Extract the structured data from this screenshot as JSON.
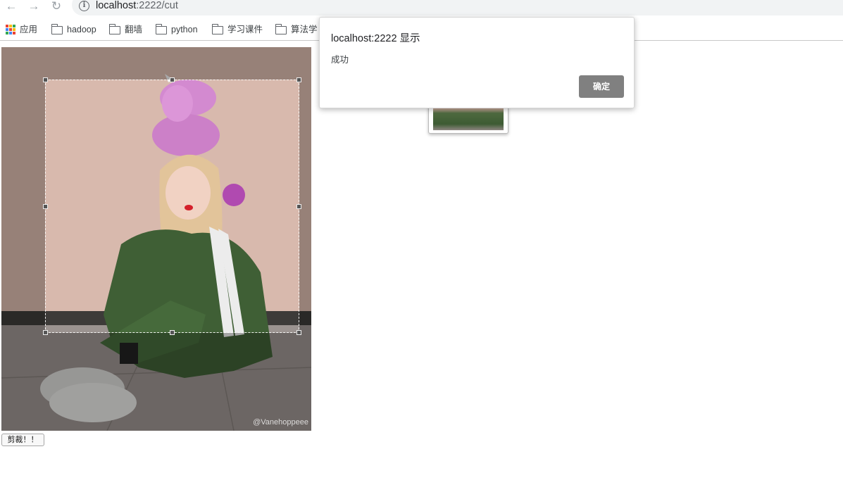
{
  "browser": {
    "url_host": "localhost",
    "url_path": ":2222/cut",
    "nav": {
      "back": "←",
      "forward": "→",
      "reload": "↻"
    }
  },
  "bookmarks": [
    {
      "label": "应用",
      "icon": "apps-grid-icon"
    },
    {
      "label": "hadoop",
      "icon": "folder-icon"
    },
    {
      "label": "翻墙",
      "icon": "folder-icon"
    },
    {
      "label": "python",
      "icon": "folder-icon"
    },
    {
      "label": "学习课件",
      "icon": "folder-icon"
    },
    {
      "label": "算法学",
      "icon": "folder-icon"
    }
  ],
  "page": {
    "watermark": "@Vanehoppeee",
    "cut_button_label": "剪裁！！"
  },
  "dialog": {
    "title": "localhost:2222 显示",
    "message": "成功",
    "ok_label": "确定"
  },
  "colors": {
    "dialog_button": "#808080",
    "crop_border": "#ffffff"
  }
}
